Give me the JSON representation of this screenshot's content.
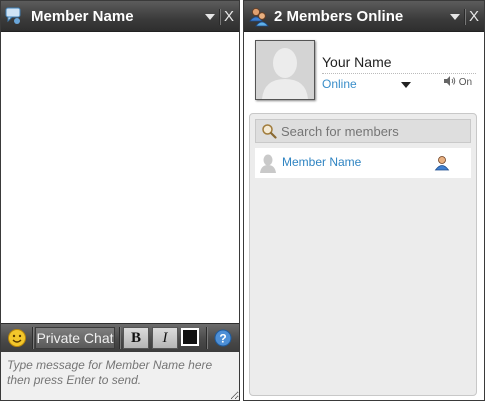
{
  "chat_window": {
    "title": "Member Name",
    "close_label": "X",
    "toolbar": {
      "private_chat_label": "Private Chat",
      "bold_label": "B",
      "italic_label": "I",
      "help_label": "?"
    },
    "input_placeholder": "Type message for Member Name here then press Enter to send."
  },
  "members_window": {
    "title": "2 Members Online",
    "close_label": "X",
    "profile": {
      "name": "Your Name",
      "status": "Online",
      "sound_label": "On"
    },
    "search_placeholder": "Search for members",
    "members": [
      {
        "name": "Member Name"
      }
    ]
  },
  "icons": {
    "chat_window": [
      "chat-bubble-icon",
      "dropdown-arrow-icon",
      "smiley-icon",
      "text-color-icon",
      "help-icon"
    ],
    "members_window": [
      "members-group-icon",
      "dropdown-arrow-icon",
      "avatar-silhouette-icon",
      "speaker-icon",
      "search-icon",
      "member-avatar-icon",
      "user-profile-icon"
    ]
  },
  "colors": {
    "titlebar": "#3b3b3b",
    "status_link": "#3a8ec9",
    "member_link": "#2f84c2",
    "list_background": "#ececec"
  }
}
